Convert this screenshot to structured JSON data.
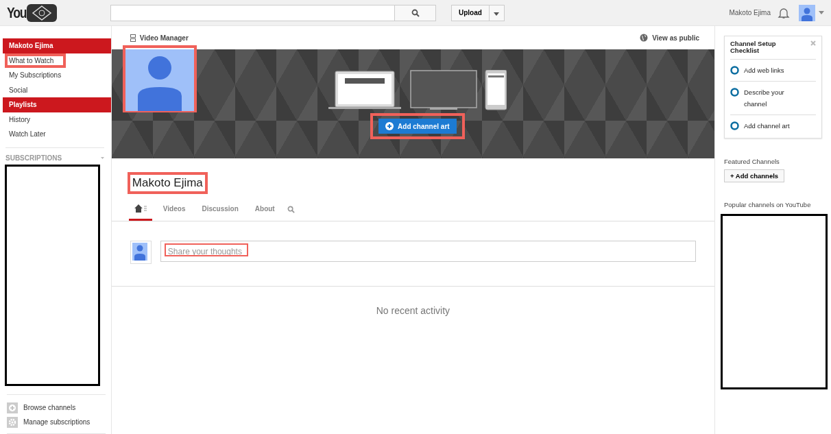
{
  "header": {
    "logo_text": "You",
    "upload_label": "Upload",
    "user_name": "Makoto Ejima"
  },
  "sidebar": {
    "items": [
      {
        "label": "Makoto Ejima",
        "kind": "header",
        "highlighted": false
      },
      {
        "label": "What to Watch",
        "kind": "link",
        "highlighted": true
      },
      {
        "label": "My Subscriptions",
        "kind": "link",
        "highlighted": false
      },
      {
        "label": "Social",
        "kind": "link",
        "highlighted": false
      },
      {
        "label": "Playlists",
        "kind": "header",
        "highlighted": false
      },
      {
        "label": "History",
        "kind": "link",
        "highlighted": false
      },
      {
        "label": "Watch Later",
        "kind": "link",
        "highlighted": false
      }
    ],
    "subscriptions_title": "SUBSCRIPTIONS",
    "footer_links": [
      {
        "label": "Browse channels",
        "kind": "add"
      },
      {
        "label": "Manage subscriptions",
        "kind": "gear"
      }
    ]
  },
  "channel": {
    "video_manager": "Video Manager",
    "view_as_public": "View as public",
    "add_art_label": "Add channel art",
    "avatar_highlighted": true,
    "add_art_highlighted": true,
    "name": "Makoto Ejima",
    "name_highlighted": true,
    "tabs": [
      {
        "kind": "home",
        "selected": true
      },
      {
        "kind": "text",
        "label": "Videos",
        "selected": false
      },
      {
        "kind": "text",
        "label": "Discussion",
        "selected": false
      },
      {
        "kind": "text",
        "label": "About",
        "selected": false
      }
    ],
    "comment_placeholder": "Share your thoughts",
    "placeholder_highlighted": true,
    "empty_message": "No recent activity"
  },
  "right": {
    "checklist_title": "Channel Setup Checklist",
    "checklist": [
      {
        "label": "Add web links",
        "checked": false
      },
      {
        "label": "Describe your channel",
        "checked": false
      },
      {
        "label": "Add channel art",
        "checked": false
      }
    ],
    "featured_title": "Featured Channels",
    "add_channels_label": "+ Add channels",
    "popular_title": "Popular channels on YouTube"
  }
}
